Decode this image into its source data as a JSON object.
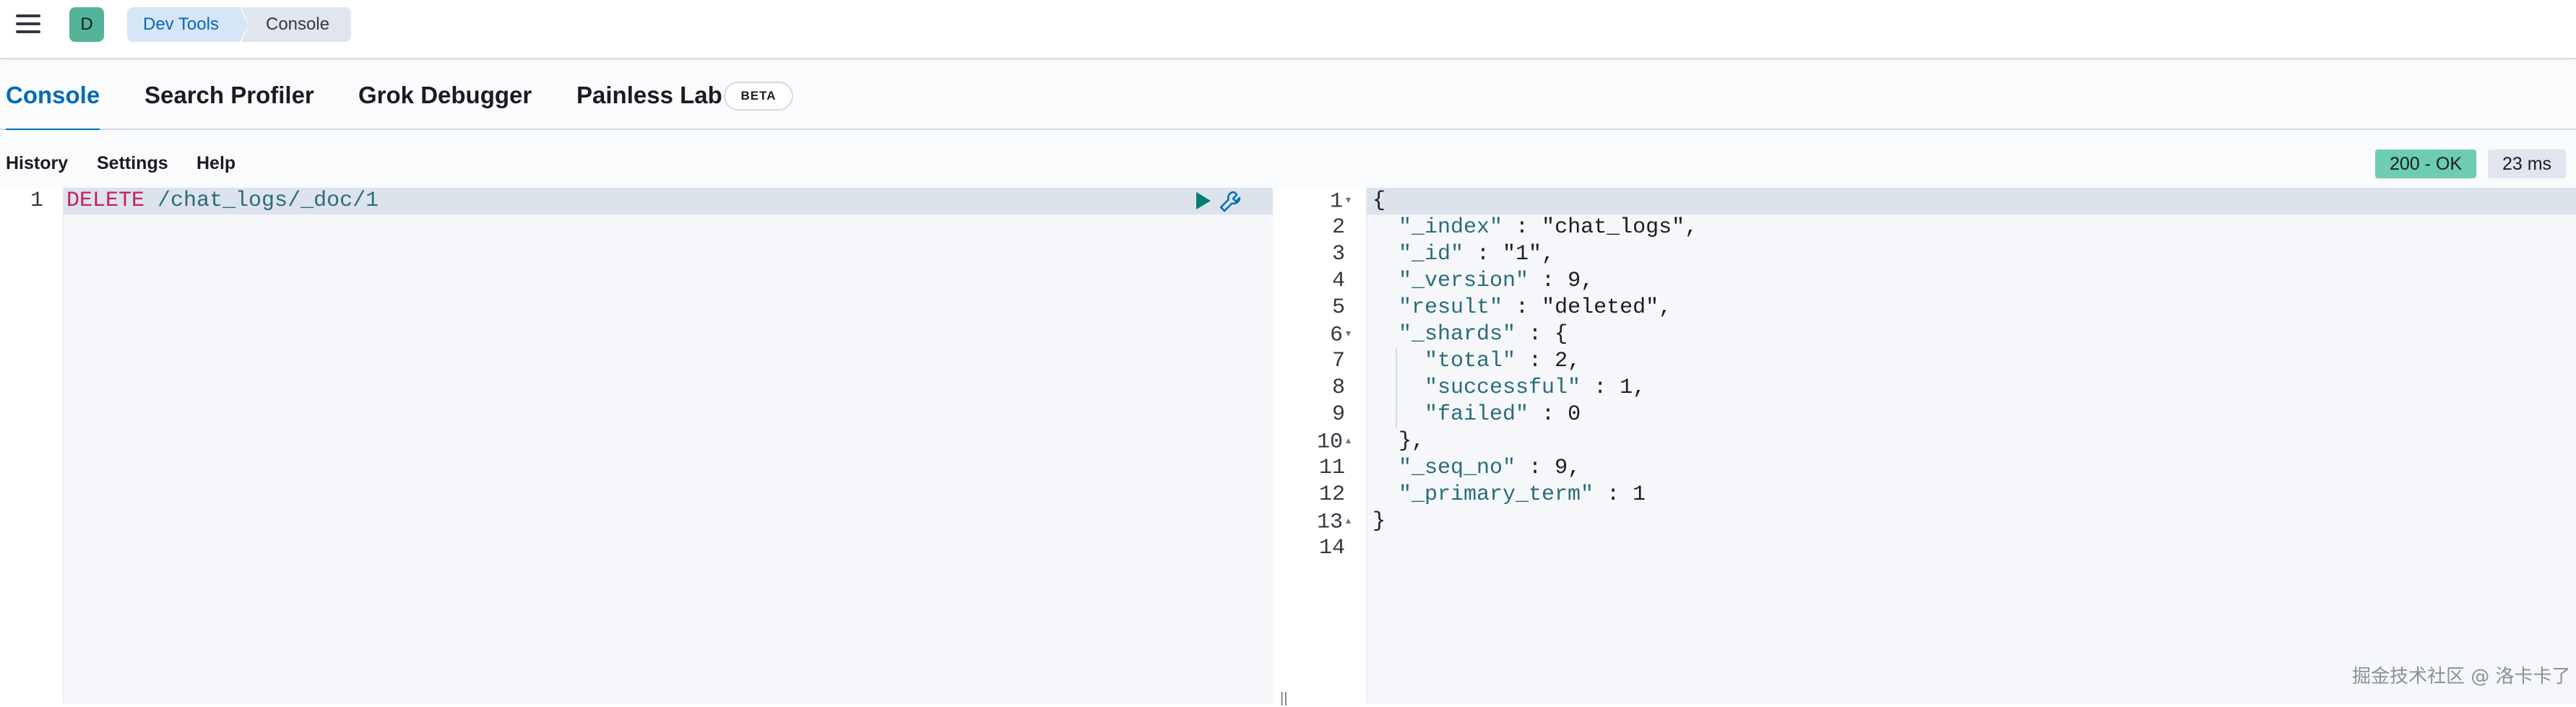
{
  "header": {
    "avatar_letter": "D",
    "breadcrumbs": [
      "Dev Tools",
      "Console"
    ]
  },
  "tabs": [
    {
      "label": "Console",
      "active": true
    },
    {
      "label": "Search Profiler",
      "active": false
    },
    {
      "label": "Grok Debugger",
      "active": false
    },
    {
      "label": "Painless Lab",
      "active": false
    }
  ],
  "beta_badge": "BETA",
  "toolbar": {
    "history": "History",
    "settings": "Settings",
    "help": "Help",
    "status": "200 - OK",
    "duration": "23 ms"
  },
  "request": {
    "line_number": "1",
    "method": "DELETE",
    "path": " /chat_logs/_doc/1"
  },
  "response": {
    "line_numbers": [
      "1",
      "2",
      "3",
      "4",
      "5",
      "6",
      "7",
      "8",
      "9",
      "10",
      "11",
      "12",
      "13",
      "14"
    ],
    "lines": [
      "{",
      "  \"_index\" : \"chat_logs\",",
      "  \"_id\" : \"1\",",
      "  \"_version\" : 9,",
      "  \"result\" : \"deleted\",",
      "  \"_shards\" : {",
      "    \"total\" : 2,",
      "    \"successful\" : 1,",
      "    \"failed\" : 0",
      "  },",
      "  \"_seq_no\" : 9,",
      "  \"_primary_term\" : 1",
      "}",
      ""
    ]
  },
  "watermark": "掘金技术社区 @ 洛卡卡了",
  "colors": {
    "accent": "#006bb8",
    "status_ok": "#6dccb1",
    "avatar": "#54b399"
  }
}
